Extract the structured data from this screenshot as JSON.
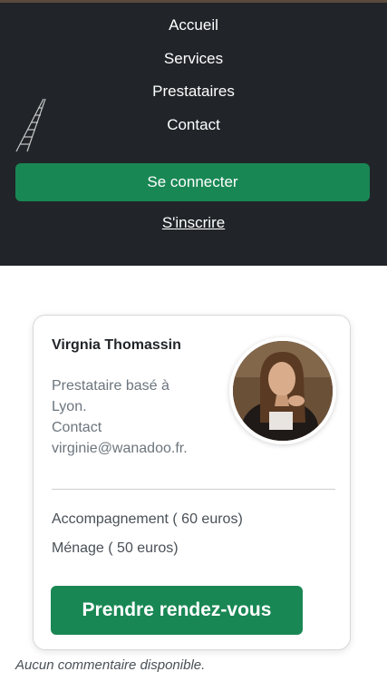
{
  "nav": {
    "items": [
      {
        "label": "Accueil"
      },
      {
        "label": "Services"
      },
      {
        "label": "Prestataires"
      },
      {
        "label": "Contact"
      }
    ],
    "login_label": "Se connecter",
    "signup_label": "S'inscrire",
    "logo_icon": "ladder-logo-icon"
  },
  "provider": {
    "name": "Virgnia Thomassin",
    "description_line1": "Prestataire basé à",
    "description_line2": "Lyon.",
    "description_line3": "Contact",
    "description_line4": "virginie@wanadoo.fr.",
    "services": [
      {
        "label": "Accompagnement ( 60 euros)"
      },
      {
        "label": "Ménage ( 50 euros)"
      }
    ],
    "cta_label": "Prendre rendez-vous"
  },
  "comments": {
    "empty_label": "Aucun commentaire disponible."
  },
  "colors": {
    "nav_bg": "#212529",
    "primary": "#198754",
    "text_muted": "#6c757d"
  }
}
